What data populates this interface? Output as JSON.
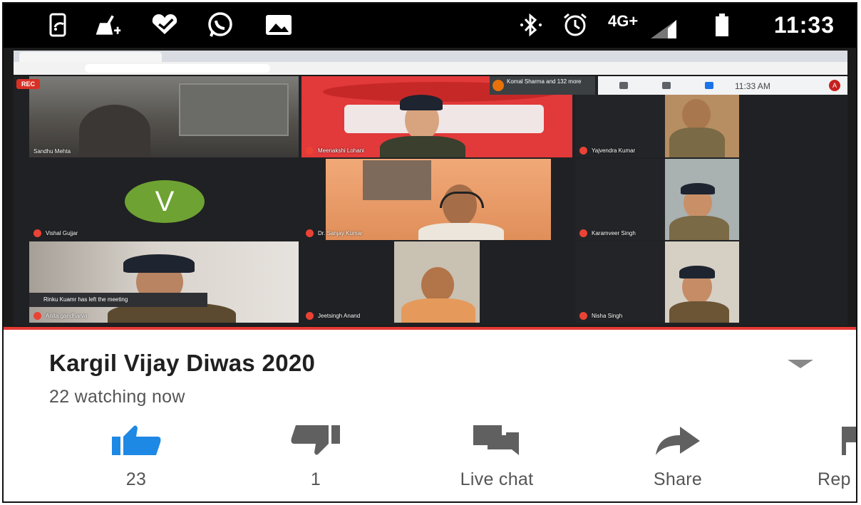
{
  "status_bar": {
    "icons": [
      "screen-cast-icon",
      "broom-icon",
      "heart-check-icon",
      "whatsapp-icon",
      "image-icon"
    ],
    "network": "4G+",
    "time": "11:33"
  },
  "meet": {
    "rec_label": "REC",
    "presenter": "Komal Sharma and 132 more",
    "meeting_time": "11:33 AM",
    "toast": "Rinku Kuamr has left the meeting",
    "participants": [
      {
        "name": "Sandhu Mehta"
      },
      {
        "name": "Meenakshi Lohani"
      },
      {
        "name": "Yajvendra Kumar"
      },
      {
        "name": "Vishal Gujjar"
      },
      {
        "name": "Dr. Sanjay Kumar"
      },
      {
        "name": "Karamveer Singh"
      },
      {
        "name": "Anita gandharva"
      },
      {
        "name": "Jeetsingh Anand"
      },
      {
        "name": "Nisha Singh"
      }
    ],
    "avatar_letter": "V"
  },
  "video_info": {
    "title": "Kargil Vijay Diwas 2020",
    "watching": "22 watching now",
    "actions": {
      "like_count": "23",
      "dislike_count": "1",
      "live_chat": "Live chat",
      "share": "Share",
      "report": "Rep"
    }
  },
  "colors": {
    "like_blue": "#1e88e5",
    "icon_gray": "#606060",
    "progress_red": "#e53935"
  }
}
